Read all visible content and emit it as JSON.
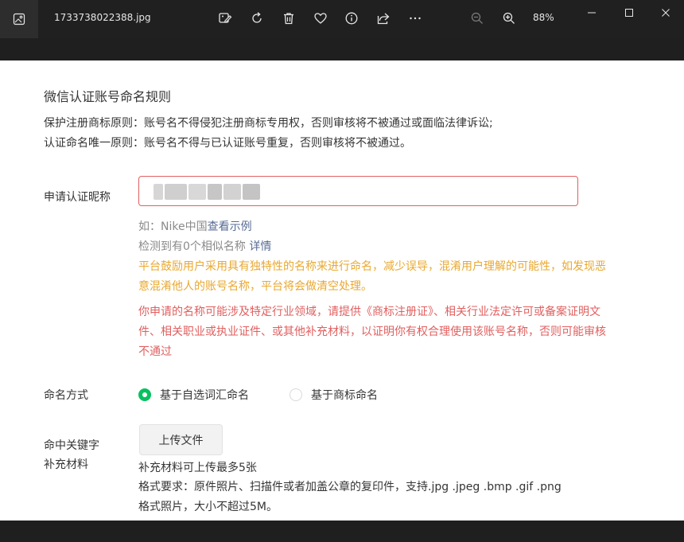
{
  "window": {
    "filename": "1733738022388.jpg",
    "zoom_level": "88%",
    "colors": {
      "titlebar": "#202020",
      "icon": "#e6e6e6"
    },
    "toolbar_icons": [
      "edit-image-icon",
      "rotate-icon",
      "delete-icon",
      "favorite-icon",
      "info-icon",
      "share-icon",
      "more-icon",
      "zoom-out-icon",
      "zoom-in-icon"
    ],
    "window_controls": [
      "minimize-icon",
      "maximize-icon",
      "close-icon"
    ]
  },
  "page": {
    "title": "微信认证账号命名规则",
    "rules": [
      "保护注册商标原则：账号名不得侵犯注册商标专用权，否则审核将不被通过或面临法律诉讼;",
      "认证命名唯一原则：账号名不得与已认证账号重复，否则审核将不被通过。"
    ],
    "nickname": {
      "label": "申请认证昵称",
      "example_prefix": "如：Nike中国",
      "example_link": "查看示例",
      "similar_text": "检测到有0个相似名称",
      "similar_link": "详情",
      "notice_orange": "平台鼓励用户采用具有独特性的名称来进行命名，减少误导，混淆用户理解的可能性，如发现恶意混淆他人的账号名称，平台将会做清空处理。",
      "notice_red": "你申请的名称可能涉及特定行业领域，请提供《商标注册证》、相关行业法定许可或备案证明文件、相关职业或执业证件、或其他补充材料，以证明你有权合理使用该账号名称，否则可能审核不通过"
    },
    "naming_method": {
      "label": "命名方式",
      "options": [
        {
          "label": "基于自选词汇命名",
          "selected": true
        },
        {
          "label": "基于商标命名",
          "selected": false
        }
      ]
    },
    "keyword": {
      "label": "命中关键字补充材料",
      "upload_label": "上传文件",
      "notes": [
        "补充材料可上传最多5张",
        "格式要求：原件照片、扫描件或者加盖公章的复印件，支持.jpg .jpeg .bmp .gif .png",
        "格式照片，大小不超过5M。"
      ]
    },
    "colors": {
      "text": "#353535",
      "muted": "#8a8a8a",
      "link": "#576b95",
      "warning": "#e9a830",
      "error": "#e15f5f",
      "accent": "#07c160"
    }
  }
}
